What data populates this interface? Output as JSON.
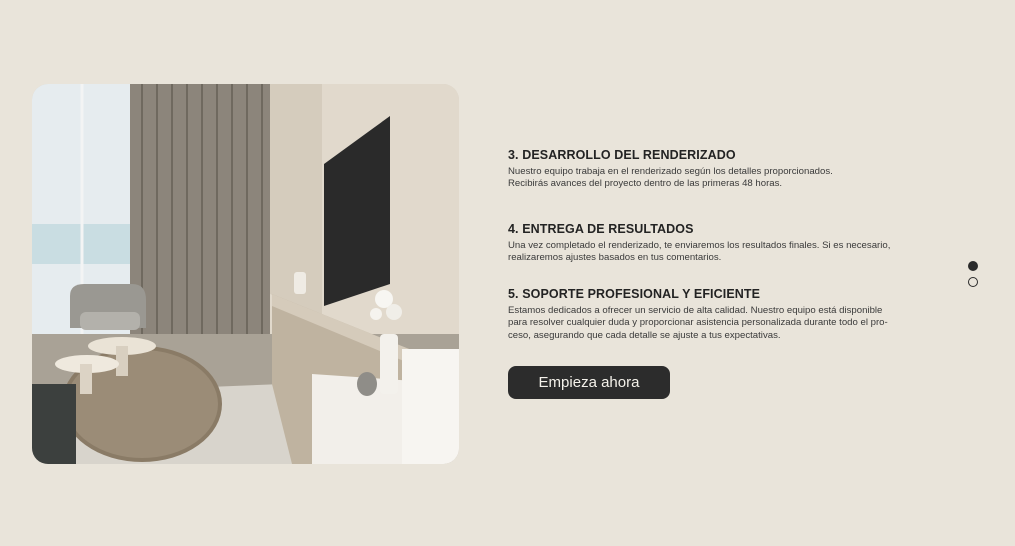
{
  "steps": [
    {
      "title": "3. DESARROLLO DEL RENDERIZADO",
      "lines": [
        "Nuestro equipo trabaja en el renderizado según los detalles proporcionados.",
        "Recibirás avances del proyecto dentro de las primeras 48 horas."
      ]
    },
    {
      "title": "4. ENTREGA DE RESULTADOS",
      "lines": [
        "Una vez completado el renderizado, te enviaremos los resultados finales. Si es necesario,",
        "realizaremos ajustes basados en tus comentarios."
      ]
    },
    {
      "title": "5. SOPORTE PROFESIONAL Y EFICIENTE",
      "lines": [
        "Estamos dedicados a ofrecer un servicio de alta calidad. Nuestro equipo está disponible",
        "para resolver cualquier duda y proporcionar asistencia personalizada durante todo el pro-",
        "ceso, asegurando que cada detalle se ajuste a tus expectativas."
      ]
    }
  ],
  "cta": {
    "label": "Empieza ahora"
  },
  "pager": {
    "total": 2,
    "active_index": 0
  },
  "colors": {
    "background": "#e9e4da",
    "button": "#2c2c2c",
    "text": "#2b2b2b"
  }
}
